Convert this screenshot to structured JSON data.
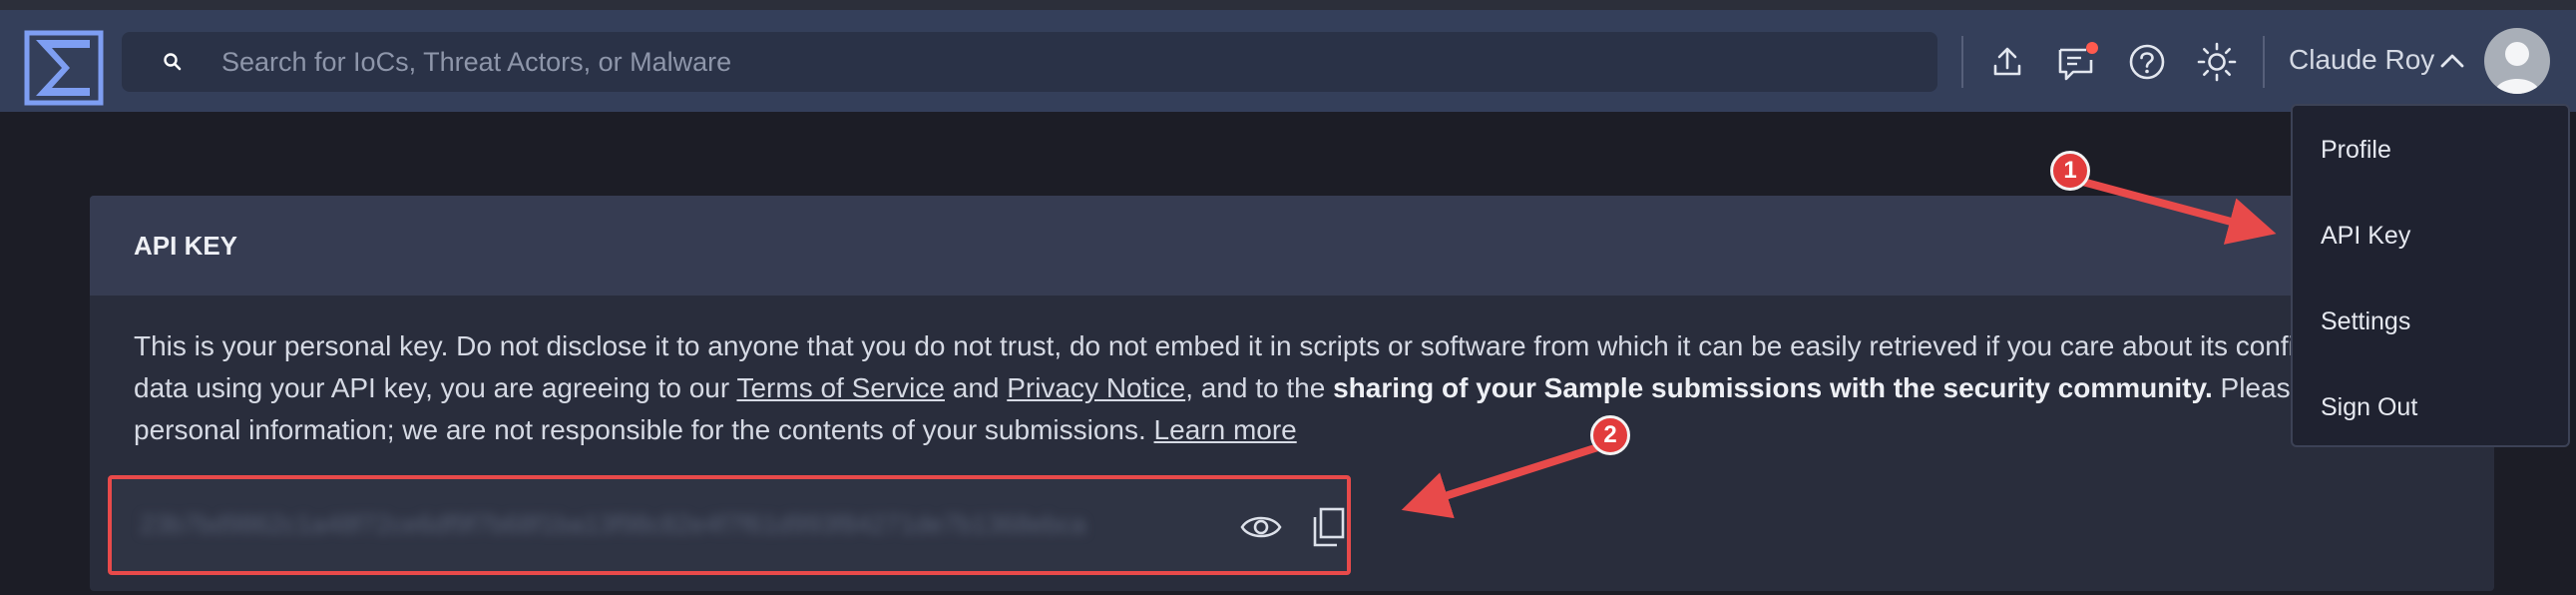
{
  "header": {
    "search_placeholder": "Search for IoCs, Threat Actors, or Malware",
    "user_name": "Claude Roy"
  },
  "card": {
    "title": "API KEY",
    "line1": "This is your personal key. Do not disclose it to anyone that you do not trust, do not embed it in scripts or software from which it can be easily retrieved if you care about its confidentiality. B",
    "line2_a": "data using your API key, you are agreeing to our ",
    "tos_link": "Terms of Service",
    "line2_b": " and ",
    "privacy_link": "Privacy Notice",
    "line2_c": ", and to the ",
    "line2_bold": "sharing of your Sample submissions with the security community.",
    "line2_d": " Please do not submit",
    "line3": "personal information; we are not responsible for the contents of your submissions. ",
    "learn_more_link": "Learn more",
    "masked_key": "23b7bd9862c1a48f72ce6df9f7b68f1ba13f98c82e4f7f61d993f84271de7b1368ebca"
  },
  "dropdown": {
    "items": [
      "Profile",
      "API Key",
      "Settings",
      "Sign Out"
    ]
  },
  "annotations": {
    "badge1": "1",
    "badge2": "2"
  },
  "colors": {
    "topbar": "#343f5a",
    "accent": "#7e9ef2",
    "annotation_red": "#e84a4a",
    "notification_dot": "#ff5a4e"
  },
  "icons": [
    "logo-icon",
    "search-icon",
    "upload-icon",
    "feedback-icon",
    "help-icon",
    "theme-icon",
    "chevron-up-icon",
    "avatar",
    "eye-icon",
    "copy-icon"
  ]
}
